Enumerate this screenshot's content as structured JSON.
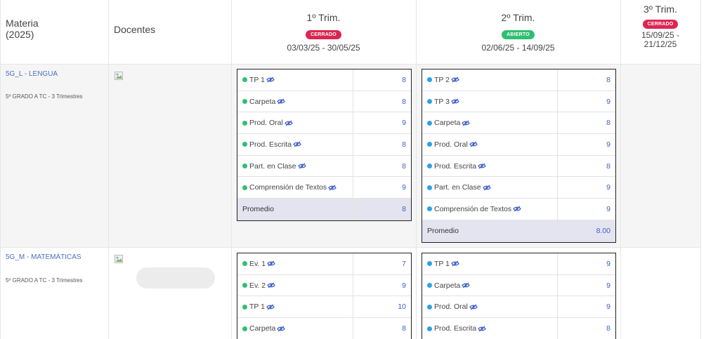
{
  "header": {
    "materia_line1": "Materia",
    "materia_line2": "(2025)",
    "docentes": "Docentes"
  },
  "trimesters": [
    {
      "title": "1º Trim.",
      "status": "CERRADO",
      "dates": "03/03/25 - 30/05/25"
    },
    {
      "title": "2º Trim.",
      "status": "ABIERTO",
      "dates": "02/06/25 - 14/09/25"
    },
    {
      "title": "3º Trim.",
      "status": "CERRADO",
      "dates_line1": "15/09/25 -",
      "dates_line2": "21/12/25"
    }
  ],
  "colors": {
    "cerrado": "#dc2651",
    "abierto": "#2fbf71",
    "link": "#4a6fc4",
    "value": "#3d5fc9",
    "dot_closed": "#2fbf71",
    "dot_open": "#2aa3e6"
  },
  "subjects": [
    {
      "name": "5G_L - LENGUA",
      "desc": "5º GRADO A TC - 3 Trimestres",
      "t1": {
        "rows": [
          {
            "label": "TP 1",
            "value": "8"
          },
          {
            "label": "Carpeta",
            "value": "8"
          },
          {
            "label": "Prod. Oral",
            "value": "9"
          },
          {
            "label": "Prod. Escrita",
            "value": "8"
          },
          {
            "label": "Part. en Clase",
            "value": "8"
          },
          {
            "label": "Comprensión de Textos",
            "value": "9"
          }
        ],
        "avg_label": "Promedio",
        "avg_value": "8"
      },
      "t2": {
        "rows": [
          {
            "label": "TP 2",
            "value": "8"
          },
          {
            "label": "TP 3",
            "value": "9"
          },
          {
            "label": "Carpeta",
            "value": "8"
          },
          {
            "label": "Prod. Oral",
            "value": "9"
          },
          {
            "label": "Prod. Escrita",
            "value": "8"
          },
          {
            "label": "Part. en Clase",
            "value": "9"
          },
          {
            "label": "Comprensión de Textos",
            "value": "9"
          }
        ],
        "avg_label": "Promedio",
        "avg_value": "8.00"
      }
    },
    {
      "name": "5G_M - MATEMÁTICAS",
      "desc": "5º GRADO A TC - 3 Trimestres",
      "t1": {
        "rows": [
          {
            "label": "Ev. 1",
            "value": "7"
          },
          {
            "label": "Ev. 2",
            "value": "9"
          },
          {
            "label": "TP 1",
            "value": "10"
          },
          {
            "label": "Carpeta",
            "value": "8"
          }
        ]
      },
      "t2": {
        "rows": [
          {
            "label": "TP 1",
            "value": "9"
          },
          {
            "label": "Carpeta",
            "value": "9"
          },
          {
            "label": "Prod. Oral",
            "value": "9"
          },
          {
            "label": "Prod. Escrita",
            "value": "8"
          }
        ]
      }
    }
  ]
}
